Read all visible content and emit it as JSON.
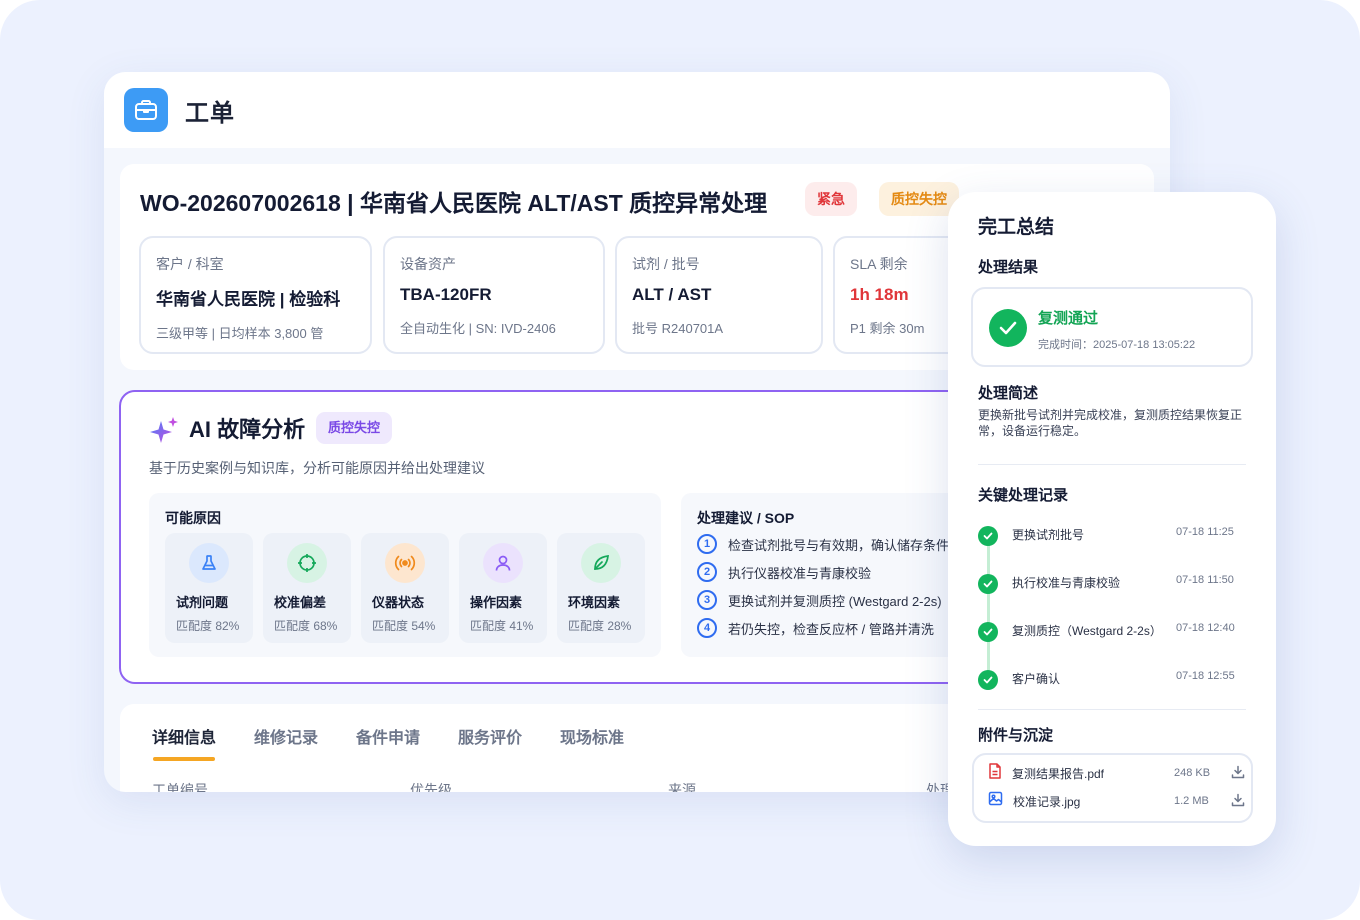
{
  "app": {
    "title": "工单"
  },
  "work_order": {
    "title": "WO-202607002618 | 华南省人民医院 ALT/AST 质控异常处理",
    "tags": {
      "urgent": "紧急",
      "qc": "质控失控"
    },
    "info": [
      {
        "label": "客户 / 科室",
        "value": "华南省人民医院 | 检验科",
        "sub": "三级甲等 | 日均样本 3,800 管"
      },
      {
        "label": "设备资产",
        "value": "TBA-120FR",
        "sub": "全自动生化 | SN: IVD-2406"
      },
      {
        "label": "试剂 / 批号",
        "value": "ALT / AST",
        "sub": "批号 R240701A"
      },
      {
        "label": "SLA 剩余",
        "value": "1h 18m",
        "sub": "P1 剩余 30m"
      }
    ]
  },
  "ai_analysis": {
    "title": "AI 故障分析",
    "tag": "质控失控",
    "description": "基于历史案例与知识库，分析可能原因并给出处理建议",
    "causes_title": "可能原因",
    "causes": [
      {
        "name": "试剂问题",
        "match": "匹配度 82%",
        "icon": "flask-icon",
        "color": "#3b82f6",
        "bg": "#dbe8fd"
      },
      {
        "name": "校准偏差",
        "match": "匹配度 68%",
        "icon": "crosshair-icon",
        "color": "#14a85a",
        "bg": "#d7f3e4"
      },
      {
        "name": "仪器状态",
        "match": "匹配度 54%",
        "icon": "signal-icon",
        "color": "#f08a1c",
        "bg": "#fde6cf"
      },
      {
        "name": "操作因素",
        "match": "匹配度 41%",
        "icon": "user-icon",
        "color": "#8b5cf6",
        "bg": "#ebe2fd"
      },
      {
        "name": "环境因素",
        "match": "匹配度 28%",
        "icon": "leaf-icon",
        "color": "#14a85a",
        "bg": "#d7f3e4"
      }
    ],
    "sop_title": "处理建议 / SOP",
    "sop": [
      {
        "num": "1",
        "text": "检查试剂批号与有效期，确认储存条件"
      },
      {
        "num": "2",
        "text": "执行仪器校准与青康校验"
      },
      {
        "num": "3",
        "text": "更换试剂并复测质控 (Westgard 2-2s)"
      },
      {
        "num": "4",
        "text": "若仍失控，检查反应杯 / 管路并清洗"
      }
    ]
  },
  "tabs": {
    "items": [
      "详细信息",
      "维修记录",
      "备件申请",
      "服务评价",
      "现场标准"
    ],
    "active": "详细信息",
    "fields": [
      "工单编号",
      "优先级",
      "来源",
      "处理"
    ]
  },
  "completion": {
    "title": "完工总结",
    "result_heading": "处理结果",
    "result_status": "复测通过",
    "result_time": "完成时间：2025-07-18 13:05:22",
    "brief_heading": "处理简述",
    "brief": "更换新批号试剂并完成校准，复测质控结果恢复正常，设备运行稳定。",
    "records_heading": "关键处理记录",
    "records": [
      {
        "text": "更换试剂批号",
        "time": "07-18 11:25"
      },
      {
        "text": "执行校准与青康校验",
        "time": "07-18 11:50"
      },
      {
        "text": "复测质控（Westgard 2-2s）",
        "time": "07-18 12:40"
      },
      {
        "text": "客户确认",
        "time": "07-18 12:55"
      }
    ],
    "attachments_heading": "附件与沉淀",
    "attachments": [
      {
        "name": "复测结果报告.pdf",
        "size": "248 KB",
        "icon": "pdf-file-icon"
      },
      {
        "name": "校准记录.jpg",
        "size": "1.2 MB",
        "icon": "image-file-icon"
      }
    ]
  },
  "colors": {
    "background": "#ecf1fe",
    "primary": "#3d9bf5",
    "ai_accent": "#8f63f2",
    "urgent": "#e0363a",
    "warning": "#e48a13",
    "success": "#12b55d",
    "tab_underline": "#f5a623"
  }
}
